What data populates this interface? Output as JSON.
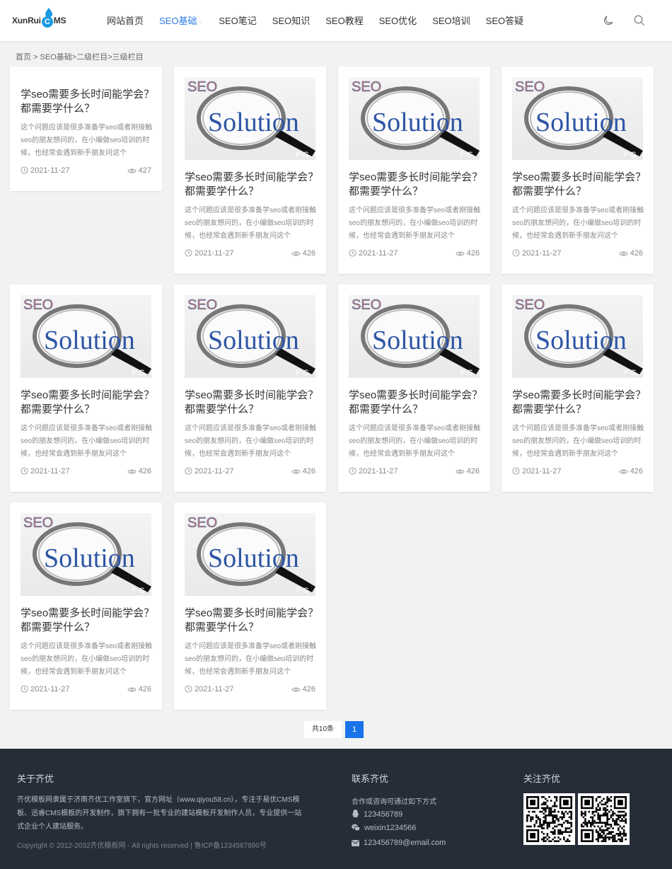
{
  "header": {
    "logo": {
      "before": "XunRui",
      "letter": "C",
      "after": "MS"
    },
    "nav": [
      {
        "label": "网站首页",
        "active": false
      },
      {
        "label": "SEO基础",
        "active": true,
        "caret": "⌵"
      },
      {
        "label": "SEO笔记",
        "active": false
      },
      {
        "label": "SEO知识",
        "active": false
      },
      {
        "label": "SEO教程",
        "active": false
      },
      {
        "label": "SEO优化",
        "active": false
      },
      {
        "label": "SEO培训",
        "active": false
      },
      {
        "label": "SEO答疑",
        "active": false
      }
    ],
    "icons": {
      "theme": "moon-icon",
      "search": "search-icon"
    }
  },
  "breadcrumb": "首页 > SEO基础>二级栏目>三级栏目",
  "thumbnail": {
    "top": "SEO",
    "main": "Solution",
    "corner": "P G"
  },
  "cards": [
    {
      "has_image": false,
      "title": "学seo需要多长时间能学会？都需要学什么？",
      "desc": "这个问题应该是很多准备学seo或者刚接触seo的朋友想问的，在小编做seo培训的时候，也经常会遇到新手朋友问这个",
      "date": "2021-11-27",
      "views": "427"
    },
    {
      "has_image": true,
      "title": "学seo需要多长时间能学会？都需要学什么？",
      "desc": "这个问题应该是很多准备学seo或者刚接触seo的朋友想问的，在小编做seo培训的时候，也经常会遇到新手朋友问这个",
      "date": "2021-11-27",
      "views": "426"
    },
    {
      "has_image": true,
      "title": "学seo需要多长时间能学会？都需要学什么？",
      "desc": "这个问题应该是很多准备学seo或者刚接触seo的朋友想问的，在小编做seo培训的时候，也经常会遇到新手朋友问这个",
      "date": "2021-11-27",
      "views": "426"
    },
    {
      "has_image": true,
      "title": "学seo需要多长时间能学会？都需要学什么？",
      "desc": "这个问题应该是很多准备学seo或者刚接触seo的朋友想问的，在小编做seo培训的时候，也经常会遇到新手朋友问这个",
      "date": "2021-11-27",
      "views": "426"
    },
    {
      "has_image": true,
      "title": "学seo需要多长时间能学会？都需要学什么？",
      "desc": "这个问题应该是很多准备学seo或者刚接触seo的朋友想问的，在小编做seo培训的时候，也经常会遇到新手朋友问这个",
      "date": "2021-11-27",
      "views": "426"
    },
    {
      "has_image": true,
      "title": "学seo需要多长时间能学会？都需要学什么？",
      "desc": "这个问题应该是很多准备学seo或者刚接触seo的朋友想问的，在小编做seo培训的时候，也经常会遇到新手朋友问这个",
      "date": "2021-11-27",
      "views": "426"
    },
    {
      "has_image": true,
      "title": "学seo需要多长时间能学会？都需要学什么？",
      "desc": "这个问题应该是很多准备学seo或者刚接触seo的朋友想问的，在小编做seo培训的时候，也经常会遇到新手朋友问这个",
      "date": "2021-11-27",
      "views": "426"
    },
    {
      "has_image": true,
      "title": "学seo需要多长时间能学会？都需要学什么？",
      "desc": "这个问题应该是很多准备学seo或者刚接触seo的朋友想问的，在小编做seo培训的时候，也经常会遇到新手朋友问这个",
      "date": "2021-11-27",
      "views": "426"
    },
    {
      "has_image": true,
      "title": "学seo需要多长时间能学会？都需要学什么？",
      "desc": "这个问题应该是很多准备学seo或者刚接触seo的朋友想问的，在小编做seo培训的时候，也经常会遇到新手朋友问这个",
      "date": "2021-11-27",
      "views": "426"
    },
    {
      "has_image": true,
      "title": "学seo需要多长时间能学会？都需要学什么？",
      "desc": "这个问题应该是很多准备学seo或者刚接触seo的朋友想问的，在小编做seo培训的时候，也经常会遇到新手朋友问这个",
      "date": "2021-11-27",
      "views": "426"
    }
  ],
  "pagination": {
    "total": "共10条",
    "current": "1"
  },
  "footer": {
    "about": {
      "title": "关于齐优",
      "text": "齐优模板网隶属于济南齐优工作室旗下，官方网址（www.qiyou58.cn），专注于易优CMS模板、迅睿CMS模板的开发制作，旗下拥有一批专业的建站模板开发制作人员，专业提供一站式企业个人建站服务。"
    },
    "copyright": "Copyright © 2012-2032齐优模板网 - All rights reserved | 鲁ICP备1234567890号",
    "contact": {
      "title": "联系齐优",
      "intro": "合作或咨询可通过如下方式",
      "qq": "123456789",
      "wechat": "weixin1234566",
      "email": "123456789@email.com"
    },
    "follow": {
      "title": "关注齐优"
    }
  }
}
